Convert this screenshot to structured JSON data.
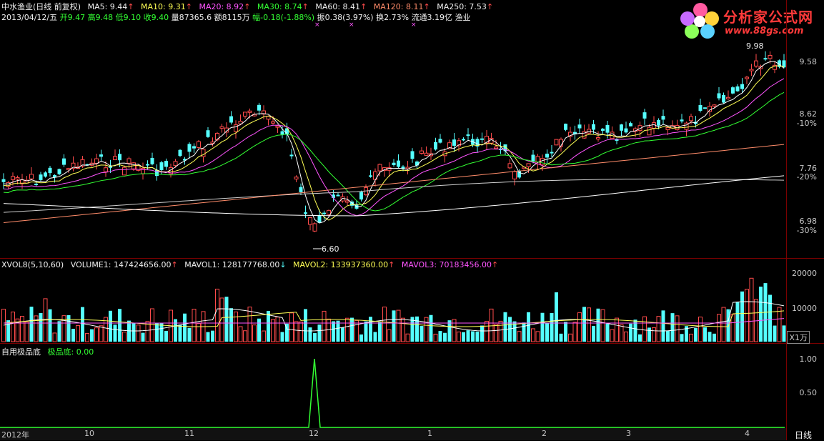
{
  "header": {
    "title": "中水渔业(日线 前复权)",
    "ma_items": [
      {
        "label": "MA5: 9.44",
        "arrow": "↑"
      },
      {
        "label": "MA10: 9.31",
        "arrow": "↑"
      },
      {
        "label": "MA20: 8.92",
        "arrow": "↑"
      },
      {
        "label": "MA30: 8.74",
        "arrow": "↑"
      },
      {
        "label": "MA60: 8.41",
        "arrow": "↑"
      },
      {
        "label": "MA120: 8.11",
        "arrow": "↑"
      },
      {
        "label": "MA250: 7.53",
        "arrow": "↑"
      }
    ],
    "quote_line": {
      "date": "2013/04/12/五",
      "open": "开9.47",
      "high": "高9.48",
      "low": "低9.10",
      "close": "收9.40",
      "volume": "量87365.6",
      "amount": "额8115万",
      "change": "幅-0.18(-1.88%)",
      "amplitude": "振0.38(3.97%)",
      "turnover": "换2.73%",
      "float": "流通3.19亿",
      "industry": "渔业"
    }
  },
  "logo": {
    "name": "分析家公式网",
    "url": "www.88gs.com"
  },
  "price_axis": {
    "labels": [
      "9.58",
      "8.62",
      "-10%",
      "7.76",
      "-20%",
      "6.98",
      "-30%"
    ]
  },
  "price_annotations": {
    "high": "9.98",
    "low": "6.60"
  },
  "volume_panel": {
    "title": "XVOL8(5,10,60)",
    "items": [
      {
        "label": "VOLUME1: 147424656.00",
        "arrow": "↑"
      },
      {
        "label": "MAVOL1: 128177768.00",
        "arrow": "↓"
      },
      {
        "label": "MAVOL2: 133937360.00",
        "arrow": "↑"
      },
      {
        "label": "MAVOL3: 70183456.00",
        "arrow": "↑"
      }
    ],
    "axis": [
      "20000",
      "10000",
      "X1万"
    ]
  },
  "indicator_panel": {
    "title": "自用极品底",
    "item": "极品底: 0.00",
    "axis": [
      "1.00",
      "0.50"
    ]
  },
  "date_axis": {
    "ticks": [
      "2012年",
      "10",
      "11",
      "12",
      "1",
      "2",
      "3",
      "4"
    ],
    "period": "日线"
  },
  "colors": {
    "up": "#ff4b4b",
    "down": "#55ffff",
    "ma5": "#ffffff",
    "ma10": "#ffff55",
    "ma20": "#ff55ff",
    "ma30": "#33ff33",
    "ma60": "#d0d0d0",
    "ma120": "#ff8c6a",
    "ma250": "#ffffff",
    "indicator": "#33ff33",
    "grid": "#7a0000"
  }
}
